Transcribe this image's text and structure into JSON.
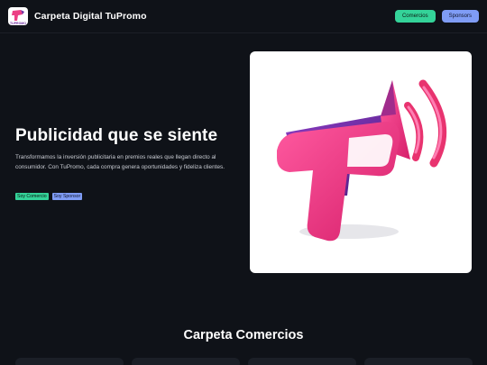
{
  "header": {
    "logo_text": "TUPROMO",
    "brand_name": "Carpeta Digital TuPromo",
    "nav": [
      {
        "label": "Comercios",
        "color": "#34d399"
      },
      {
        "label": "Sponsors",
        "color": "#7f9cf5"
      }
    ]
  },
  "hero": {
    "title": "Publicidad que se siente",
    "description": "Transformamos la inversión publicitaria en premios reales que llegan directo al consumidor. Con TuPromo, cada compra genera oportunidades y fideliza clientes.",
    "buttons": [
      {
        "label": "Soy Comercio"
      },
      {
        "label": "Soy Sponsor"
      }
    ],
    "image_icon": "tupromo-megaphone-logo"
  },
  "section": {
    "title": "Carpeta Comercios"
  },
  "colors": {
    "background": "#0f1218",
    "accent_green": "#34d399",
    "accent_blue": "#7f9cf5",
    "brand_pink": "#ec3f84",
    "brand_purple": "#6d2ea0"
  }
}
